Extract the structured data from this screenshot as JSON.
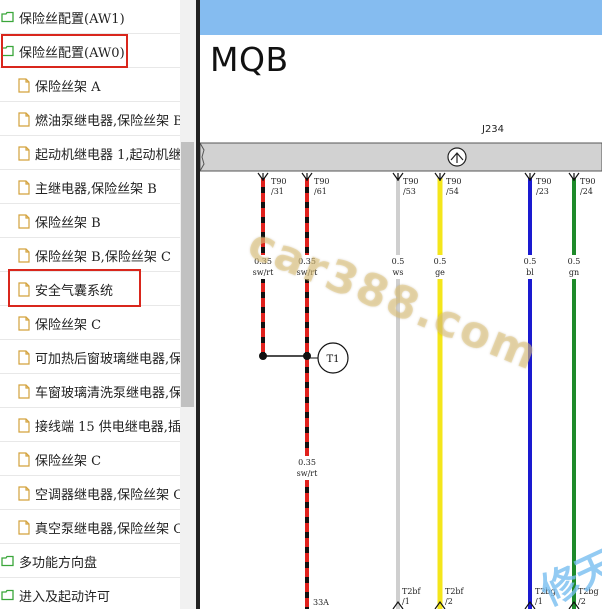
{
  "tree": {
    "items": [
      {
        "label": "保险丝配置(AW1)",
        "type": "folder"
      },
      {
        "label": "保险丝配置(AW0)",
        "type": "folder-open"
      },
      {
        "label": "保险丝架 A",
        "type": "doc"
      },
      {
        "label": "燃油泵继电器,保险丝架 B",
        "type": "doc"
      },
      {
        "label": "起动机继电器 1,起动机继",
        "type": "doc"
      },
      {
        "label": "主继电器,保险丝架 B",
        "type": "doc"
      },
      {
        "label": "保险丝架 B",
        "type": "doc"
      },
      {
        "label": "保险丝架 B,保险丝架 C",
        "type": "doc"
      },
      {
        "label": "安全气囊系统",
        "type": "doc"
      },
      {
        "label": "保险丝架 C",
        "type": "doc"
      },
      {
        "label": "可加热后窗玻璃继电器,保",
        "type": "doc"
      },
      {
        "label": "车窗玻璃清洗泵继电器,保",
        "type": "doc"
      },
      {
        "label": "接线端 15 供电继电器,插",
        "type": "doc"
      },
      {
        "label": "保险丝架 C",
        "type": "doc"
      },
      {
        "label": "空调器继电器,保险丝架 C",
        "type": "doc"
      },
      {
        "label": "真空泵继电器,保险丝架 C",
        "type": "doc"
      },
      {
        "label": "多功能方向盘",
        "type": "folder"
      },
      {
        "label": "进入及起动许可",
        "type": "folder"
      }
    ]
  },
  "diagram": {
    "title": "MQB",
    "component": "J234",
    "pins": [
      {
        "connector": "T90",
        "pin": "/31",
        "size": "0.35",
        "color_code": "sw/rt"
      },
      {
        "connector": "T90",
        "pin": "/61",
        "size": "0.35",
        "color_code": "sw/rt"
      },
      {
        "connector": "T90",
        "pin": "/53",
        "size": "0.5",
        "color_code": "ws"
      },
      {
        "connector": "T90",
        "pin": "/54",
        "size": "0.5",
        "color_code": "ge"
      },
      {
        "connector": "T90",
        "pin": "/23",
        "size": "0.5",
        "color_code": "bl"
      },
      {
        "connector": "T90",
        "pin": "/24",
        "size": "0.5",
        "color_code": "gn"
      }
    ],
    "junction": "T1",
    "mid_label_size": "0.35",
    "mid_label_code": "sw/rt",
    "bottom_labels": [
      "33A",
      "T2bf",
      "/1",
      "T2bf",
      "/2",
      "T2bg",
      "/1",
      "T2bg",
      "/2"
    ],
    "watermark": "car388.com",
    "watermark2": "修天",
    "colors": {
      "header": "#85bcf0",
      "highlight": "#d9261c",
      "wire_red": "#e0201c",
      "wire_yellow": "#f4e61b",
      "wire_blue": "#1a1ad0",
      "wire_green": "#1e8a2a"
    }
  }
}
